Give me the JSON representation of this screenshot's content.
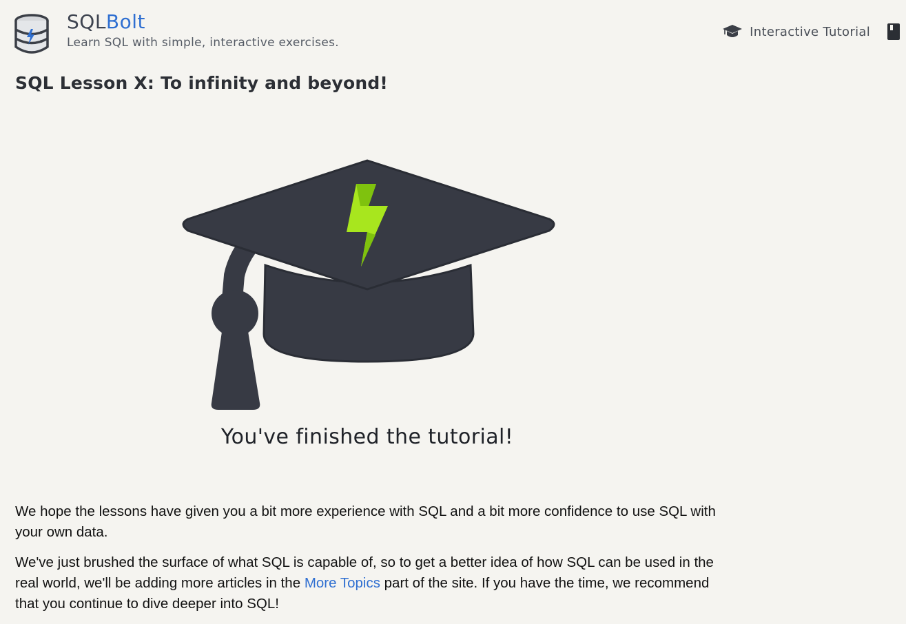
{
  "header": {
    "brand_prefix": "SQL",
    "brand_accent": "Bolt",
    "tagline": "Learn SQL with simple, interactive exercises.",
    "nav": {
      "tutorial_label": "Interactive Tutorial"
    }
  },
  "icons": {
    "logo": "database-bolt-icon",
    "tutorial": "graduation-cap-icon",
    "book": "book-icon",
    "hero": "graduation-cap-bolt-illustration"
  },
  "lesson": {
    "title": "SQL Lesson X: To infinity and beyond!",
    "finished_message": "You've finished the tutorial!",
    "paragraph1": "We hope the lessons have given you a bit more experience with SQL and a bit more confidence to use SQL with your own data.",
    "paragraph2_before": "We've just brushed the surface of what SQL is capable of, so to get a better idea of how SQL can be used in the real world, we'll be adding more articles in the ",
    "paragraph2_link": "More Topics",
    "paragraph2_after": " part of the site. If you have the time, we recommend that you continue to dive deeper into SQL!"
  },
  "colors": {
    "background": "#f5f4f0",
    "accent": "#2f6fd1",
    "cap": "#373a44",
    "bolt": "#a8e61e"
  }
}
